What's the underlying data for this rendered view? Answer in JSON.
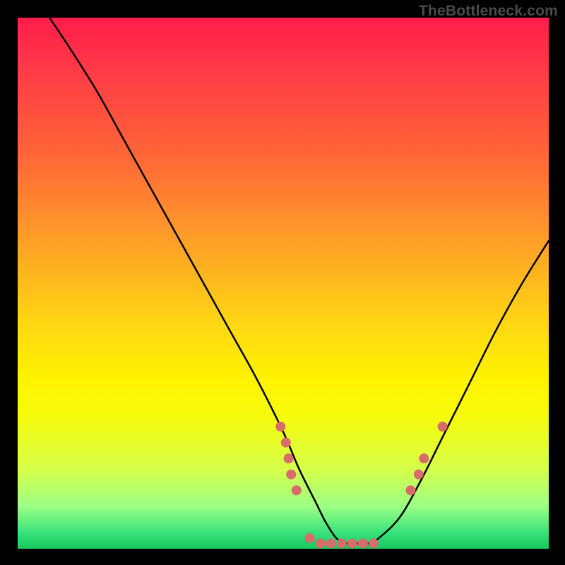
{
  "watermark": "TheBottleneck.com",
  "chart_data": {
    "type": "line",
    "title": "",
    "xlabel": "",
    "ylabel": "",
    "xlim": [
      0,
      100
    ],
    "ylim": [
      0,
      100
    ],
    "series": [
      {
        "name": "bottleneck-curve",
        "x": [
          6,
          10,
          15,
          20,
          25,
          30,
          35,
          40,
          45,
          50,
          53,
          56,
          58,
          60,
          62,
          64,
          66,
          68,
          72,
          76,
          80,
          85,
          90,
          95,
          100
        ],
        "y": [
          100,
          94,
          86,
          77,
          68,
          59,
          50,
          41,
          32,
          22,
          15,
          9,
          5,
          2,
          1,
          1,
          1,
          2,
          6,
          13,
          21,
          31,
          41,
          50,
          58
        ]
      }
    ],
    "markers": [
      {
        "x": 49.5,
        "y": 23
      },
      {
        "x": 50.5,
        "y": 20
      },
      {
        "x": 51.0,
        "y": 17
      },
      {
        "x": 51.5,
        "y": 14
      },
      {
        "x": 52.5,
        "y": 11
      },
      {
        "x": 55.0,
        "y": 2
      },
      {
        "x": 57.0,
        "y": 1
      },
      {
        "x": 59.0,
        "y": 1
      },
      {
        "x": 61.0,
        "y": 1
      },
      {
        "x": 63.0,
        "y": 1
      },
      {
        "x": 65.0,
        "y": 1
      },
      {
        "x": 67.0,
        "y": 1
      },
      {
        "x": 74.0,
        "y": 11
      },
      {
        "x": 75.5,
        "y": 14
      },
      {
        "x": 76.5,
        "y": 17
      },
      {
        "x": 80.0,
        "y": 23
      }
    ],
    "marker_color": "#d86b6b",
    "marker_radius": 7
  }
}
